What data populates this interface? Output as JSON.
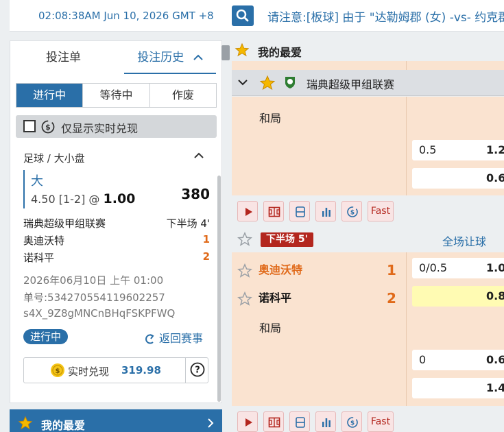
{
  "header": {
    "clock": "02:08:38AM Jun 10, 2026 GMT +8",
    "announcement": "请注意:[板球] 由于 \"达勒姆郡 (女) -vs- 约克郡"
  },
  "left_panel": {
    "tabs": [
      "投注单",
      "投注历史"
    ],
    "status_tabs": [
      "进行中",
      "等待中",
      "作废"
    ],
    "cashout_filter": "仅显示实时兑现",
    "bet": {
      "sport_market": "足球 / 大小盘",
      "pick": "大",
      "odds_prefix": "4.50 [1-2] @ ",
      "odds": "1.00",
      "stake": "380",
      "league": "瑞典超级甲组联赛",
      "period": "下半场 4'",
      "home_team": "奥迪沃特",
      "home_score": "1",
      "away_team": "诺科平",
      "away_score": "2",
      "datetime": "2026年06月10日 上午 01:00",
      "ticket": "单号:534270554119602257",
      "ref": "s4X_9Z8gMNCnBHqFSKPFWQ",
      "status": "进行中",
      "back_link": "返回赛事",
      "cashout_label": "实时兑现",
      "cashout_value": "319.98"
    },
    "favorites": "我的最爱"
  },
  "main": {
    "section_title": "我的最爱",
    "league": "瑞典超级甲组联赛",
    "match1": {
      "draw": "和局",
      "odds": [
        {
          "line": "0.5",
          "price": "1.2"
        },
        {
          "line": "",
          "price": "0.6"
        }
      ]
    },
    "toolbar": {
      "fast": "Fast"
    },
    "live": {
      "period": "下半场",
      "minute": "5'",
      "market": "全场让球"
    },
    "match2": {
      "home": "奥迪沃特",
      "home_score": "1",
      "away": "诺科平",
      "away_score": "2",
      "draw": "和局",
      "odds": [
        {
          "line": "0/0.5",
          "price": "1.0"
        },
        {
          "line": "",
          "price": "0.8"
        },
        {
          "line": "0",
          "price": "0.6"
        },
        {
          "line": "",
          "price": "1.4"
        }
      ]
    }
  },
  "colors": {
    "brand_blue": "#2a6fa8",
    "live_red": "#b3261e",
    "score_orange": "#e06a1a",
    "match_bg": "#fae3d0",
    "highlight_yellow": "#fffbb3"
  }
}
